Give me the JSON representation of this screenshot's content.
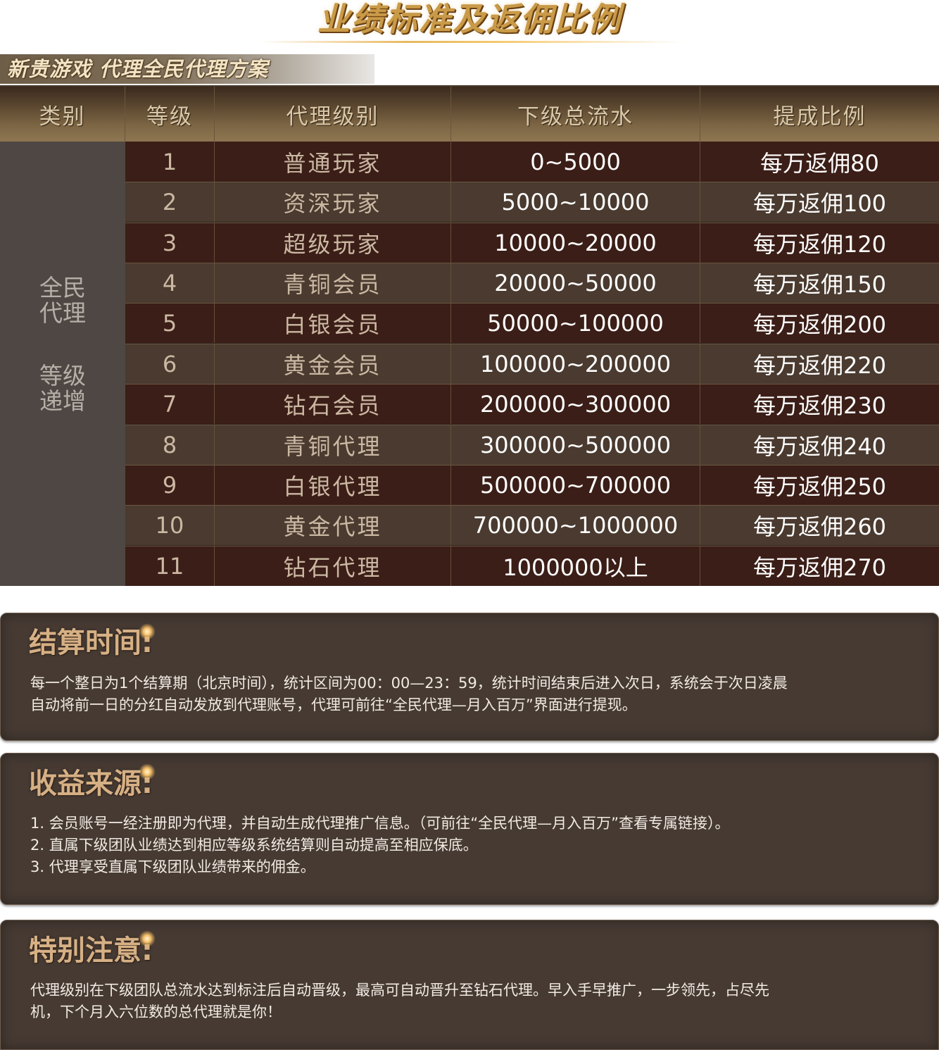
{
  "main_title": "业绩标准及返佣比例",
  "sub_banner": "新贵游戏  代理全民代理方案",
  "table": {
    "headers": [
      "类别",
      "等级",
      "代理级别",
      "下级总流水",
      "提成比例"
    ],
    "category_line1": "全民\n代理",
    "category_line2": "等级\n递增",
    "rows": [
      {
        "level": "1",
        "name": "普通玩家",
        "flow": "0~5000",
        "rate": "每万返佣80"
      },
      {
        "level": "2",
        "name": "资深玩家",
        "flow": "5000~10000",
        "rate": "每万返佣100"
      },
      {
        "level": "3",
        "name": "超级玩家",
        "flow": "10000~20000",
        "rate": "每万返佣120"
      },
      {
        "level": "4",
        "name": "青铜会员",
        "flow": "20000~50000",
        "rate": "每万返佣150"
      },
      {
        "level": "5",
        "name": "白银会员",
        "flow": "50000~100000",
        "rate": "每万返佣200"
      },
      {
        "level": "6",
        "name": "黄金会员",
        "flow": "100000~200000",
        "rate": "每万返佣220"
      },
      {
        "level": "7",
        "name": "钻石会员",
        "flow": "200000~300000",
        "rate": "每万返佣230"
      },
      {
        "level": "8",
        "name": "青铜代理",
        "flow": "300000~500000",
        "rate": "每万返佣240"
      },
      {
        "level": "9",
        "name": "白银代理",
        "flow": "500000~700000",
        "rate": "每万返佣250"
      },
      {
        "level": "10",
        "name": "黄金代理",
        "flow": "700000~1000000",
        "rate": "每万返佣260"
      },
      {
        "level": "11",
        "name": "钻石代理",
        "flow": "1000000以上",
        "rate": "每万返佣270"
      }
    ]
  },
  "sections": {
    "settlement": {
      "title": "结算时间:",
      "lines": [
        "每一个整日为1个结算期（北京时间），统计区间为00：00—23：59，统计时间结束后进入次日，系统会于次日凌晨",
        "自动将前一日的分红自动发放到代理账号，代理可前往“全民代理—月入百万”界面进行提现。"
      ]
    },
    "income": {
      "title": "收益来源:",
      "lines": [
        "1. 会员账号一经注册即为代理，并自动生成代理推广信息。（可前往“全民代理—月入百万”查看专属链接）。",
        "2. 直属下级团队业绩达到相应等级系统结算则自动提高至相应保底。",
        "3. 代理享受直属下级团队业绩带来的佣金。"
      ]
    },
    "notice": {
      "title": "特别注意:",
      "lines": [
        "代理级别在下级团队总流水达到标注后自动晋级，最高可自动晋升至钻石代理。早入手早推广，一步领先，占尽先",
        "机，下个月入六位数的总代理就是你！"
      ]
    }
  },
  "colors": {
    "gold": "#c99a48",
    "row_dark": "#3b1e17",
    "row_light": "#4a3a2f",
    "card_bg": "#463a33",
    "category_bg": "#4f4743"
  }
}
